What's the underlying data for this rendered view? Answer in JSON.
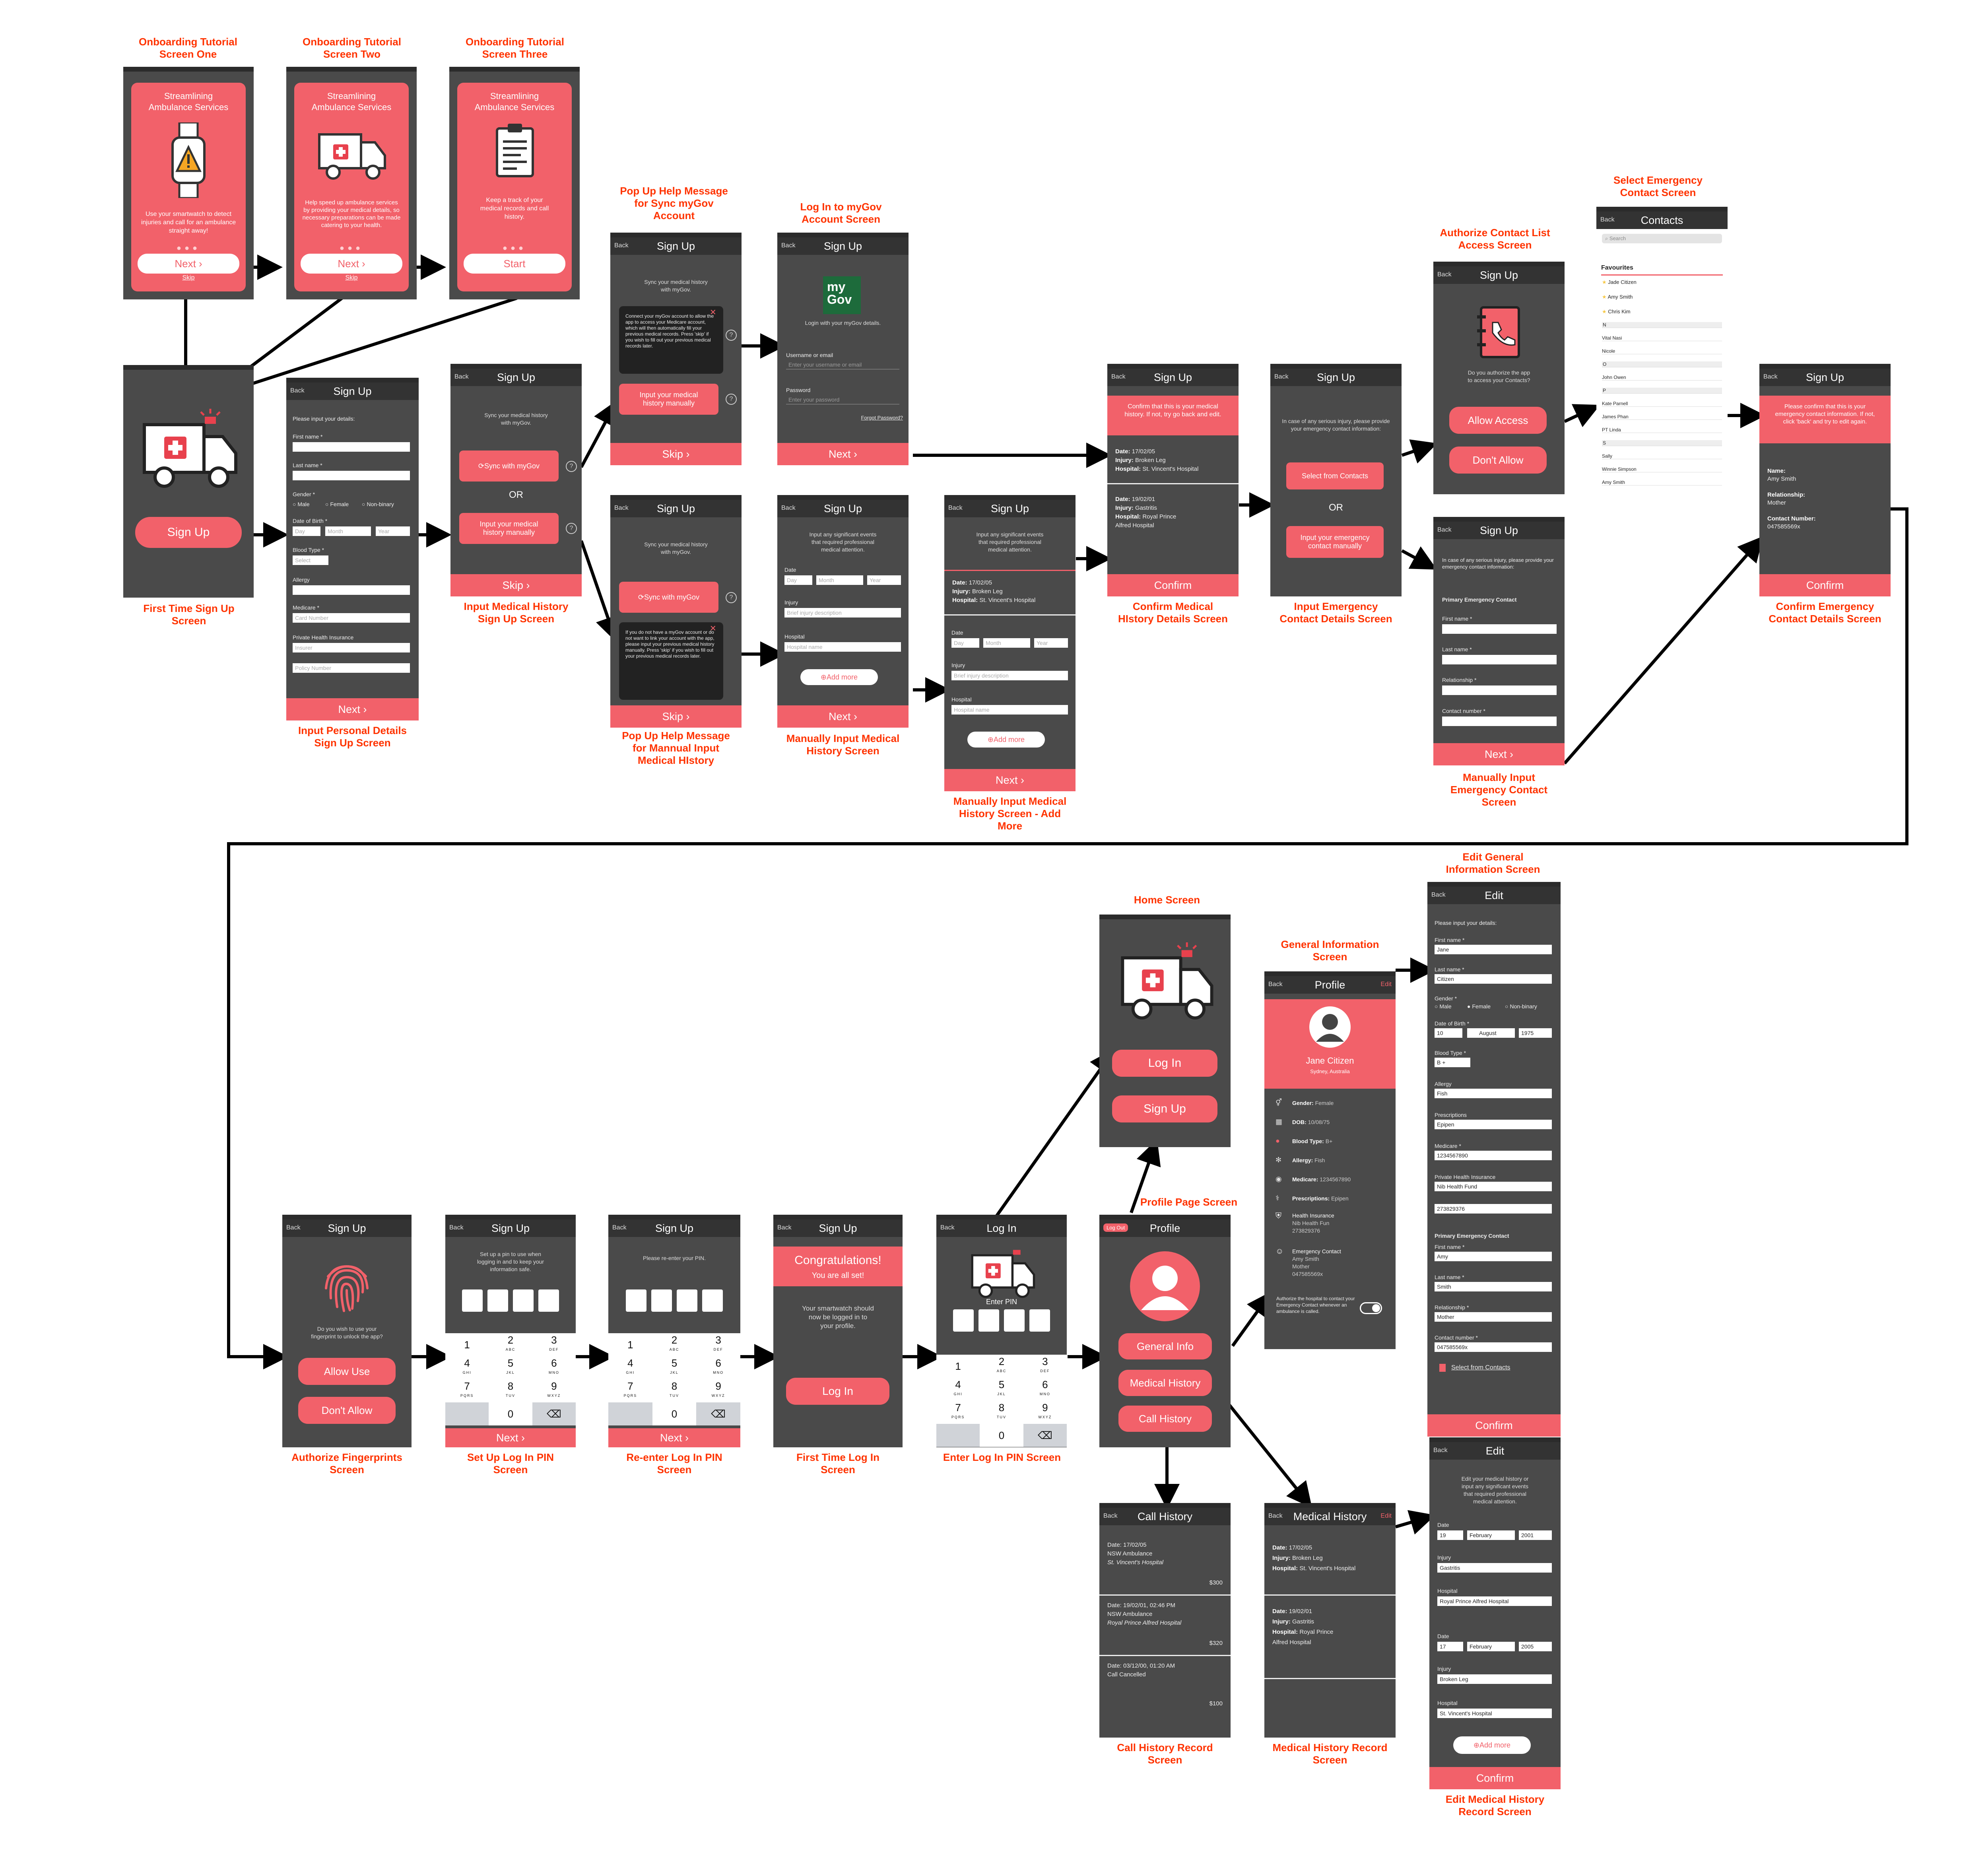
{
  "captions": {
    "ob1": "Onboarding Tutorial\nScreen One",
    "ob2": "Onboarding Tutorial\nScreen Two",
    "ob3": "Onboarding Tutorial\nScreen Three",
    "popSync": "Pop Up Help Message\nfor Sync myGov\nAccount",
    "loginMyGov": "Log In to myGov\nAccount Screen",
    "selectContact": "Select Emergency\nContact Screen",
    "authContact": "Authorize Contact List\nAccess Screen",
    "firstSignUp": "First Time Sign Up\nScreen",
    "personal": "Input Personal Details\nSign Up Screen",
    "medHist": "Input Medical History\nSign Up Screen",
    "popManual": "Pop Up Help Message\nfor Mannual Input\nMedical HIstory",
    "manualMed": "Manually Input Medical\nHistory Screen",
    "manualMedMore": "Manually Input Medical\nHistory Screen - Add\nMore",
    "confirmMed": "Confirm Medical\nHIstory Details Screen",
    "inputEmerg": "Input Emergency\nContact Details Screen",
    "manualEmerg": "Manually Input\nEmergency Contact\nScreen",
    "confirmEmerg": "Confirm Emergency\nContact Details Screen",
    "home": "Home Screen",
    "genInfo": "General Information\nScreen",
    "editGen": "Edit General\nInformation Screen",
    "authFp": "Authorize Fingerprints\nScreen",
    "setPin": "Set Up Log In PIN\nScreen",
    "rePin": "Re-enter Log In PIN\nScreen",
    "firstLogin": "First Time Log In\nScreen",
    "enterPin": "Enter Log In PIN Screen",
    "profile": "Profile Page Screen",
    "callRec": "Call History Record\nScreen",
    "medRec": "Medical History Record\nScreen",
    "editMedRec": "Edit Medical History\nRecord Screen"
  },
  "common": {
    "back": "Back",
    "signup": "Sign Up",
    "next": "Next ›",
    "skip": "Skip ›",
    "skipLink": "Skip",
    "confirm": "Confirm",
    "or": "OR",
    "edit": "Edit",
    "addMore": "Add more",
    "start": "Start"
  },
  "onboarding": {
    "title": "Streamlining\nAmbulance Services",
    "desc1": "Use your smartwatch to detect injuries and call for an ambulance straight away!",
    "desc2": "Help speed up ambulance services by providing your medical details, so necessary preparations can be made catering to your health.",
    "desc3": "Keep a track of your medical records and call history.",
    "dots": "●●●"
  },
  "personal": {
    "intro": "Please input your details:",
    "first": "First name *",
    "last": "Last name *",
    "gender": "Gender *",
    "male": "Male",
    "female": "Female",
    "nonbinary": "Non-binary",
    "dob": "Date of Birth *",
    "day": "Day",
    "month": "Month",
    "year": "Year",
    "blood": "Blood Type *",
    "select": "Select",
    "allergy": "Allergy",
    "medicare": "Medicare *",
    "cardNum": "Card Number",
    "phi": "Private Health Insurance",
    "insurer": "Insurer",
    "policy": "Policy Number"
  },
  "medHist": {
    "intro": "Sync your medical history\nwith myGov.",
    "sync": "Sync with myGov",
    "manual": "Input your medical\nhistory manually",
    "popSync": "Connect your myGov account to allow the app to access your Medicare account, which will then automatically fill your previous medical records. Press 'skip' if you wish to fill out your previous medical records later.",
    "popManual": "If you do not have a myGov account or do not want to link your account with the app, please input your previous medical history manually. Press 'skip' if you wish to fill out your previous medical records later."
  },
  "mygov": {
    "logo": "my\nGov",
    "intro": "Login with your myGov details.",
    "user": "Username or email",
    "userPh": "Enter your username or email",
    "pass": "Password",
    "passPh": "Enter your password",
    "forgot": "Forgot Password?"
  },
  "manualMed": {
    "intro": "Input any significant events\nthat required professional\nmedical attention.",
    "date": "Date",
    "injury": "Injury",
    "injuryPh": "Brief injury description",
    "hospital": "Hospital",
    "hospitalPh": "Hospital name"
  },
  "records": [
    {
      "date": "Date:",
      "dateV": "17/02/05",
      "injury": "Injury:",
      "injuryV": "Broken Leg",
      "hosp": "Hospital:",
      "hospV": "St. Vincent's Hospital"
    },
    {
      "date": "Date:",
      "dateV": "19/02/01",
      "injury": "Injury:",
      "injuryV": "Gastritis",
      "hosp": "Hospital:",
      "hospV": "Royal Prince\nAlfred Hospital"
    }
  ],
  "confirmMed": {
    "banner": "Confirm that this is your medical history. If not, try go back and edit."
  },
  "emerg": {
    "intro": "In case of any serious injury, please provide your emergency contact information:",
    "fromContacts": "Select from Contacts",
    "manual": "Input your emergency\ncontact manually",
    "primary": "Primary Emergency Contact",
    "first": "First name *",
    "last": "Last name *",
    "rel": "Relationship *",
    "num": "Contact number *"
  },
  "authContact": {
    "q": "Do you authorize the app\nto access your Contacts?",
    "allow": "Allow Access",
    "deny": "Don't Allow"
  },
  "contacts": {
    "title": "Contacts",
    "search": "Search",
    "fav": "Favourites",
    "favs": [
      "Jade Citizen",
      "Amy Smith",
      "Chris Kim"
    ],
    "list": [
      "N",
      "Vital Nasi",
      "Nicole",
      "O",
      "John Owen",
      "P",
      "Kate Parnell",
      "James Phan",
      "PT Linda",
      "S",
      "Sally",
      "Winnie Simpson",
      "Amy Smith"
    ]
  },
  "confirmEmerg": {
    "banner": "Please confirm that this is your emergency contact information. If not, click 'back' and try to edit again.",
    "name": "Name:",
    "nameV": "Amy Smith",
    "rel": "Relationship:",
    "relV": "Mother",
    "num": "Contact Number:",
    "numV": "047585569x"
  },
  "fp": {
    "q": "Do you wish to use your\nfingerprint to unlock the app?",
    "allow": "Allow Use",
    "deny": "Don't Allow"
  },
  "pin": {
    "setup": "Set up a pin to use when\nlogging in and to keep your\ninformation safe.",
    "reenter": "Please re-enter your PIN.",
    "enter": "Enter PIN",
    "keys": [
      {
        "n": "1",
        "l": ""
      },
      {
        "n": "2",
        "l": "ABC"
      },
      {
        "n": "3",
        "l": "DEF"
      },
      {
        "n": "4",
        "l": "GHI"
      },
      {
        "n": "5",
        "l": "JKL"
      },
      {
        "n": "6",
        "l": "MNO"
      },
      {
        "n": "7",
        "l": "PQRS"
      },
      {
        "n": "8",
        "l": "TUV"
      },
      {
        "n": "9",
        "l": "WXYZ"
      },
      {
        "n": "",
        "l": ""
      },
      {
        "n": "0",
        "l": ""
      },
      {
        "n": "⌫",
        "l": ""
      }
    ]
  },
  "firstLogin": {
    "congrats": "Congratulations!",
    "sub": "You are all set!",
    "msg": "Your smartwatch should\nnow be logged in to\nyour profile.",
    "btn": "Log In"
  },
  "login": {
    "title": "Log In"
  },
  "home": {
    "login": "Log In",
    "signup": "Sign Up"
  },
  "profile": {
    "title": "Profile",
    "logout": "Log Out",
    "genInfo": "General Info",
    "medHist": "Medical History",
    "callHist": "Call History"
  },
  "genInfo": {
    "name": "Jane Citizen",
    "loc": "Sydney, Australia",
    "rows": [
      {
        "k": "Gender:",
        "v": "Female"
      },
      {
        "k": "DOB:",
        "v": "10/08/75"
      },
      {
        "k": "Blood Type:",
        "v": "B+"
      },
      {
        "k": "Allergy:",
        "v": "Fish"
      },
      {
        "k": "Medicare:",
        "v": "1234567890"
      },
      {
        "k": "Prescriptions:",
        "v": "Epipen"
      }
    ],
    "hi": "Health Insurance",
    "hiV": "Nib Health Fun\n273829376",
    "ec": "Emergency Contact",
    "ecV": "Amy Smith\nMother\n047585569x",
    "auth": "Authorize the hospital to contact your Emergency Contact whenever an ambulance is called."
  },
  "editGen": {
    "title": "Edit",
    "intro": "Please input your details:",
    "first": "First name *",
    "firstV": "Jane",
    "last": "Last name *",
    "lastV": "Citizen",
    "gender": "Gender *",
    "dob": "Date of Birth *",
    "dV": "10",
    "mV": "August",
    "yV": "1975",
    "blood": "Blood Type *",
    "bloodV": "B +",
    "allergy": "Allergy",
    "allergyV": "Fish",
    "presc": "Prescriptions",
    "prescV": "Epipen",
    "medicare": "Medicare *",
    "medicareV": "1234567890",
    "phi": "Private Health Insurance",
    "phiV": "Nib Health Fund",
    "policyV": "273829376",
    "primary": "Primary Emergency Contact",
    "efirst": "First name *",
    "efirstV": "Amy",
    "elast": "Last name *",
    "elastV": "Smith",
    "rel": "Relationship *",
    "relV": "Mother",
    "num": "Contact number *",
    "numV": "047585569x",
    "select": "Select from Contacts"
  },
  "callHist": {
    "title": "Call History",
    "items": [
      {
        "date": "Date: 17/02/05",
        "org": "NSW Ambulance",
        "hosp": "St. Vincent's Hospital",
        "cost": "$300"
      },
      {
        "date": "Date: 19/02/01, 02:46 PM",
        "org": "NSW Ambulance",
        "hosp": "Royal Prince Alfred Hospital",
        "cost": "$320"
      },
      {
        "date": "Date: 03/12/00, 01:20 AM",
        "org": "Call Cancelled",
        "hosp": "",
        "cost": "$100"
      }
    ]
  },
  "medRec": {
    "title": "Medical History"
  },
  "editMed": {
    "title": "Edit",
    "intro": "Edit your medical history or\ninput any significant events\nthat required professional\nmedical attention.",
    "date": "Date",
    "injury": "Injury",
    "hospital": "Hospital",
    "r1": {
      "d": "19",
      "m": "February",
      "y": "2001",
      "inj": "Gastritis",
      "hosp": "Royal Prince Alfred Hospital"
    },
    "r2": {
      "d": "17",
      "m": "February",
      "y": "2005",
      "inj": "Broken Leg",
      "hosp": "St. Vincent's Hospital"
    }
  }
}
